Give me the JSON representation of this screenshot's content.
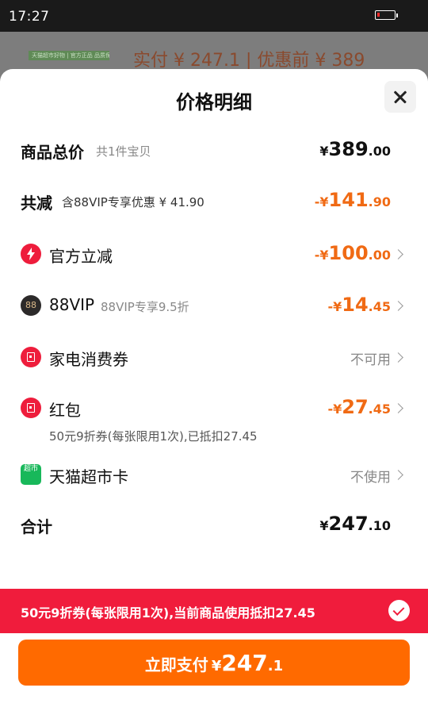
{
  "status_bar": {
    "time": "17:27",
    "battery_level_percent": 15
  },
  "background": {
    "tag_text": "天猫超市好物 | 官方正品 品质保证",
    "price_text": "实付 ¥ 247.1 | 优惠前 ¥ 389"
  },
  "sheet": {
    "title": "价格明细",
    "total": {
      "label": "商品总价",
      "sub": "共1件宝贝",
      "currency": "¥",
      "int": "389",
      "dec": ".00"
    },
    "reduced": {
      "label": "共减",
      "sub": "含88VIP专享优惠 ¥ 41.90",
      "currency": "-¥",
      "int": "141",
      "dec": ".90"
    },
    "official": {
      "label": "官方立减",
      "currency": "-¥",
      "int": "100",
      "dec": ".00"
    },
    "vip": {
      "icon_text": "88",
      "label": "88VIP",
      "sub": "88VIP专享9.5折",
      "currency": "-¥",
      "int": "14",
      "dec": ".45"
    },
    "appliance": {
      "label": "家电消费券",
      "status": "不可用"
    },
    "redpacket": {
      "label": "红包",
      "sub": "50元9折券(每张限用1次),已抵扣27.45",
      "currency": "-¥",
      "int": "27",
      "dec": ".45"
    },
    "tmall_card": {
      "icon_text": "超市",
      "label": "天猫超市卡",
      "status": "不使用"
    },
    "sum": {
      "label": "合计",
      "currency": "¥",
      "int": "247",
      "dec": ".10"
    }
  },
  "notice": {
    "text": "50元9折券(每张限用1次),当前商品使用抵扣27.45"
  },
  "pay_button": {
    "label": "立即支付",
    "currency": "¥",
    "int": "247",
    "dec": ".1"
  },
  "colors": {
    "accent_orange": "#f06a14",
    "notice_red": "#f01c3c",
    "button_orange": "#ff6a00"
  },
  "icons": [
    "lightning-icon",
    "vip-88-icon",
    "coupon-icon",
    "red-packet-icon",
    "supermarket-card-icon",
    "close-icon",
    "check-icon",
    "chevron-right-icon"
  ]
}
